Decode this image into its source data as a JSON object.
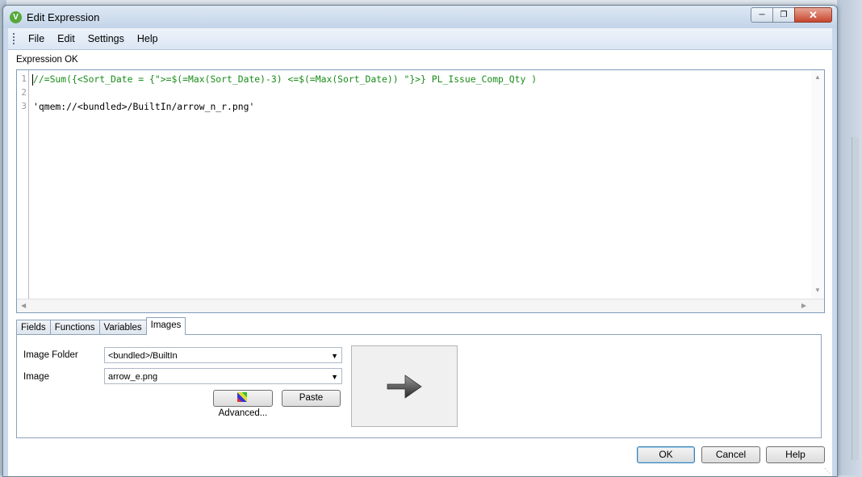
{
  "window": {
    "title": "Edit Expression"
  },
  "menu": [
    "File",
    "Edit",
    "Settings",
    "Help"
  ],
  "status": "Expression OK",
  "editor": {
    "lines": [
      {
        "num": "1",
        "text": "//=Sum({<Sort_Date = {\">=$(=Max(Sort_Date)-3) <=$(=Max(Sort_Date)) \"}>} PL_Issue_Comp_Qty )"
      },
      {
        "num": "2",
        "text": ""
      },
      {
        "num": "3",
        "text": "'qmem://<bundled>/BuiltIn/arrow_n_r.png'"
      }
    ]
  },
  "tabs": [
    "Fields",
    "Functions",
    "Variables",
    "Images"
  ],
  "images": {
    "folder_label": "Image Folder",
    "folder_value": "<bundled>/BuiltIn",
    "image_label": "Image",
    "image_value": "arrow_e.png",
    "advanced_label": "Advanced...",
    "paste_label": "Paste"
  },
  "buttons": {
    "ok": "OK",
    "cancel": "Cancel",
    "help": "Help"
  }
}
